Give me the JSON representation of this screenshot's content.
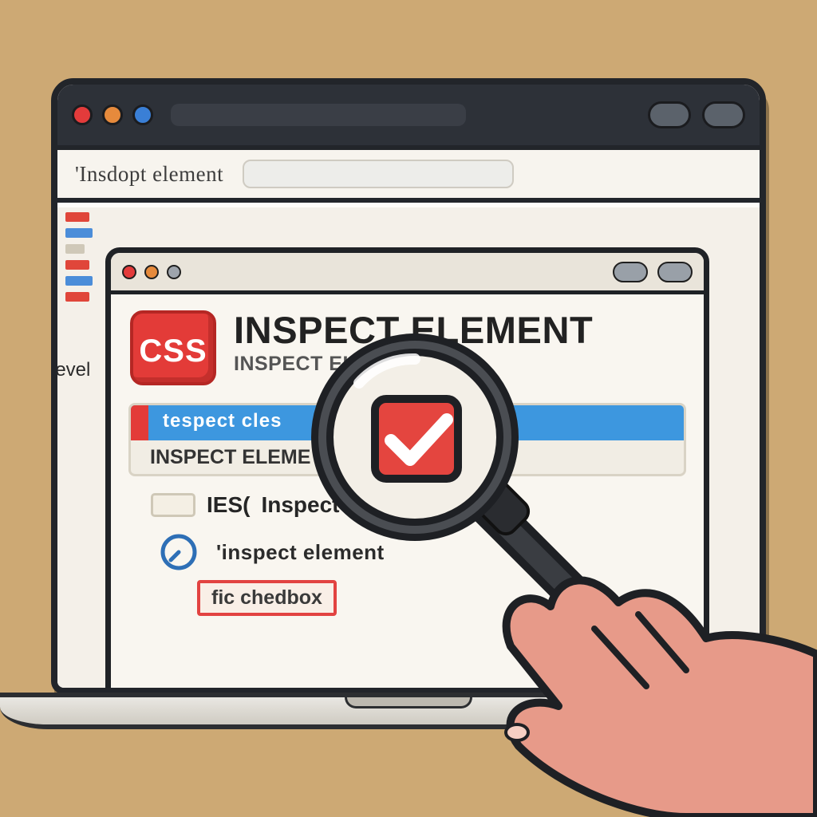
{
  "outer": {
    "address_label": "'Insdopt element"
  },
  "sidebar": {
    "devel_label": "Devel"
  },
  "inner": {
    "badge": "CSS",
    "title": "INSPECT ELEMENT",
    "subtitle": "INSPECT ELEMEN",
    "sel_top_label": "tespect cles",
    "sel_bottom_label": "Inspect eleme",
    "row2_prefix": "IES(",
    "row2_main": "Inspect",
    "row3_text": "'inspect element",
    "row4_text": "fic chedbox"
  }
}
